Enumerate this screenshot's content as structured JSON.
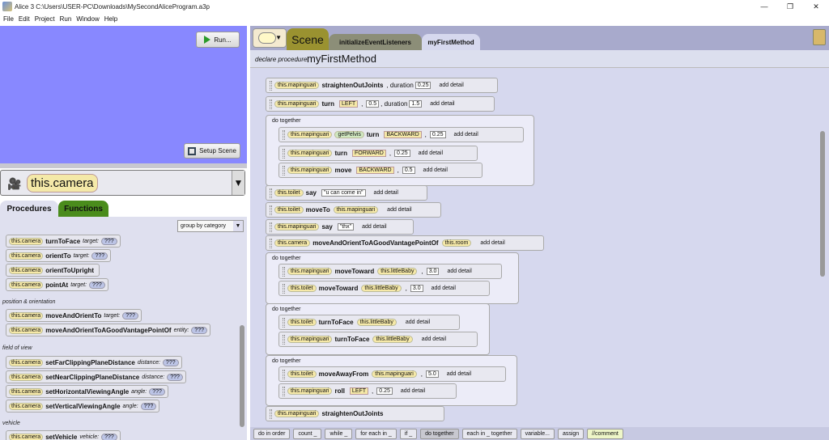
{
  "window": {
    "title": "Alice 3 C:\\Users\\USER-PC\\Downloads\\MySecondAliceProgram.a3p",
    "minimize": "—",
    "restore": "❐",
    "close": "✕"
  },
  "menu": [
    "File",
    "Edit",
    "Project",
    "Run",
    "Window",
    "Help"
  ],
  "scene": {
    "run_label": "Run...",
    "setup_label": "Setup Scene"
  },
  "selector": {
    "value": "this.camera",
    "arrow": "▼"
  },
  "tabs": {
    "procedures": "Procedures",
    "functions": "Functions"
  },
  "groupby": {
    "label": "group by category",
    "arrow": "▼"
  },
  "categories": {
    "pos": "position & orientation",
    "fov": "field of view",
    "vehicle": "vehicle"
  },
  "procs": [
    {
      "obj": "this.camera",
      "name": "turnToFace",
      "arg": "target:",
      "q": "???"
    },
    {
      "obj": "this.camera",
      "name": "orientTo",
      "arg": "target:",
      "q": "???"
    },
    {
      "obj": "this.camera",
      "name": "orientToUpright",
      "arg": "",
      "q": ""
    },
    {
      "obj": "this.camera",
      "name": "pointAt",
      "arg": "target:",
      "q": "???"
    },
    {
      "obj": "this.camera",
      "name": "moveAndOrientTo",
      "arg": "target:",
      "q": "???"
    },
    {
      "obj": "this.camera",
      "name": "moveAndOrientToAGoodVantagePointOf",
      "arg": "entity:",
      "q": "???"
    },
    {
      "obj": "this.camera",
      "name": "setFarClippingPlaneDistance",
      "arg": "distance:",
      "q": "???"
    },
    {
      "obj": "this.camera",
      "name": "setNearClippingPlaneDistance",
      "arg": "distance:",
      "q": "???"
    },
    {
      "obj": "this.camera",
      "name": "setHorizontalViewingAngle",
      "arg": "angle:",
      "q": "???"
    },
    {
      "obj": "this.camera",
      "name": "setVerticalViewingAngle",
      "arg": "angle:",
      "q": "???"
    },
    {
      "obj": "this.camera",
      "name": "setVehicle",
      "arg": "vehicle:",
      "q": "???"
    }
  ],
  "code": {
    "scene_tab": "Scene",
    "init_tab": "initializeEventListeners",
    "method_tab": "myFirstMethod",
    "declare_label": "declare procedure",
    "method_name": "myFirstMethod",
    "do_together": "do together",
    "add_detail": "add detail",
    "s1": {
      "obj": "this.mapinguari",
      "kw": "straightenOutJoints",
      "tail": ", duration",
      "n": "0.25"
    },
    "s2": {
      "obj": "this.mapinguari",
      "kw": "turn",
      "dir": "LEFT",
      "n": "0.5",
      "tail": ", duration",
      "n2": "1.5"
    },
    "s3": {
      "obj": "this.mapinguari",
      "fn": "getPelvis",
      "kw": "turn",
      "dir": "BACKWARD",
      "n": "0.25"
    },
    "s4": {
      "obj": "this.mapinguari",
      "kw": "turn",
      "dir": "FORWARD",
      "n": "0.25"
    },
    "s5": {
      "obj": "this.mapinguari",
      "kw": "move",
      "dir": "BACKWARD",
      "n": "0.5"
    },
    "s6": {
      "obj": "this.toilet",
      "kw": "say",
      "txt": "\"u can come in\""
    },
    "s7": {
      "obj": "this.toilet",
      "kw": "moveTo",
      "arg": "this.mapinguari"
    },
    "s8": {
      "obj": "this.mapinguari",
      "kw": "say",
      "txt": "\"thx\""
    },
    "s9": {
      "obj": "this.camera",
      "kw": "moveAndOrientToAGoodVantagePointOf",
      "arg": "this.room"
    },
    "s10": {
      "obj": "this.mapinguari",
      "kw": "moveToward",
      "arg": "this.littleBaby",
      "n": "3.0"
    },
    "s11": {
      "obj": "this.toilet",
      "kw": "moveToward",
      "arg": "this.littleBaby",
      "n": "3.0"
    },
    "s12": {
      "obj": "this.toilet",
      "kw": "turnToFace",
      "arg": "this.littleBaby"
    },
    "s13": {
      "obj": "this.mapinguari",
      "kw": "turnToFace",
      "arg": "this.littleBaby"
    },
    "s14": {
      "obj": "this.toilet",
      "kw": "moveAwayFrom",
      "arg": "this.mapinguari",
      "n": "5.0"
    },
    "s15": {
      "obj": "this.mapinguari",
      "kw": "roll",
      "dir": "LEFT",
      "n": "0.25"
    },
    "s16": {
      "obj": "this.mapinguari",
      "kw": "straightenOutJoints"
    }
  },
  "bottom": [
    "do in order",
    "count _",
    "while _",
    "for each in _",
    "if _",
    "do together",
    "each in _ together",
    "variable...",
    "assign",
    "//comment"
  ]
}
